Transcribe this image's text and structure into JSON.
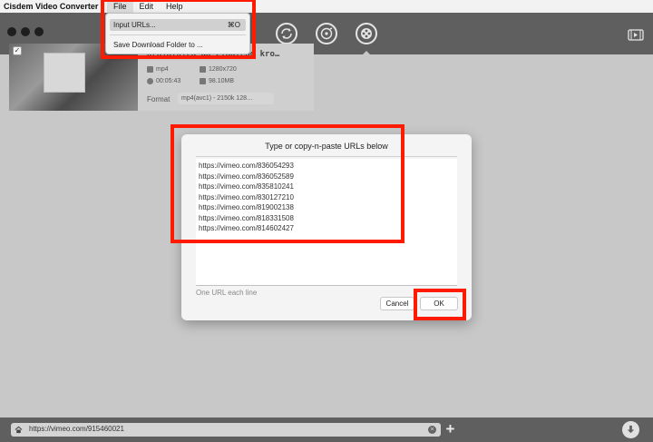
{
  "menubar": {
    "app_name": "Cisdem Video Converter",
    "menus": [
      "File",
      "Edit",
      "Help"
    ]
  },
  "file_menu": {
    "items": [
      {
        "label": "Input URLs...",
        "shortcut": "⌘O"
      },
      {
        "label": "Save Download Folder to ...",
        "shortcut": ""
      }
    ]
  },
  "toolbar": {
    "icons": [
      "convert-icon",
      "rip-icon",
      "download-icon"
    ],
    "right_icon": "video-clip-icon"
  },
  "video": {
    "title": "Krajalnica do ciągłego kro…",
    "format": "mp4",
    "resolution": "1280x720",
    "duration": "00:05:43",
    "size": "98.10MB",
    "format_label": "Format",
    "format_value": "mp4(avc1) - 2150k 128…"
  },
  "dialog": {
    "title": "Type or copy-n-paste URLs below",
    "urls": [
      "https://vimeo.com/836054293",
      "https://vimeo.com/836052589",
      "https://vimeo.com/835810241",
      "https://vimeo.com/830127210",
      "https://vimeo.com/819002138",
      "https://vimeo.com/818331508",
      "https://vimeo.com/814602427"
    ],
    "hint": "One URL each line",
    "cancel_label": "Cancel",
    "ok_label": "OK"
  },
  "bottombar": {
    "url": "https://vimeo.com/915460021",
    "plus_label": "+"
  },
  "colors": {
    "annotation": "#ff1a00",
    "toolbar": "#5f5f5f"
  }
}
